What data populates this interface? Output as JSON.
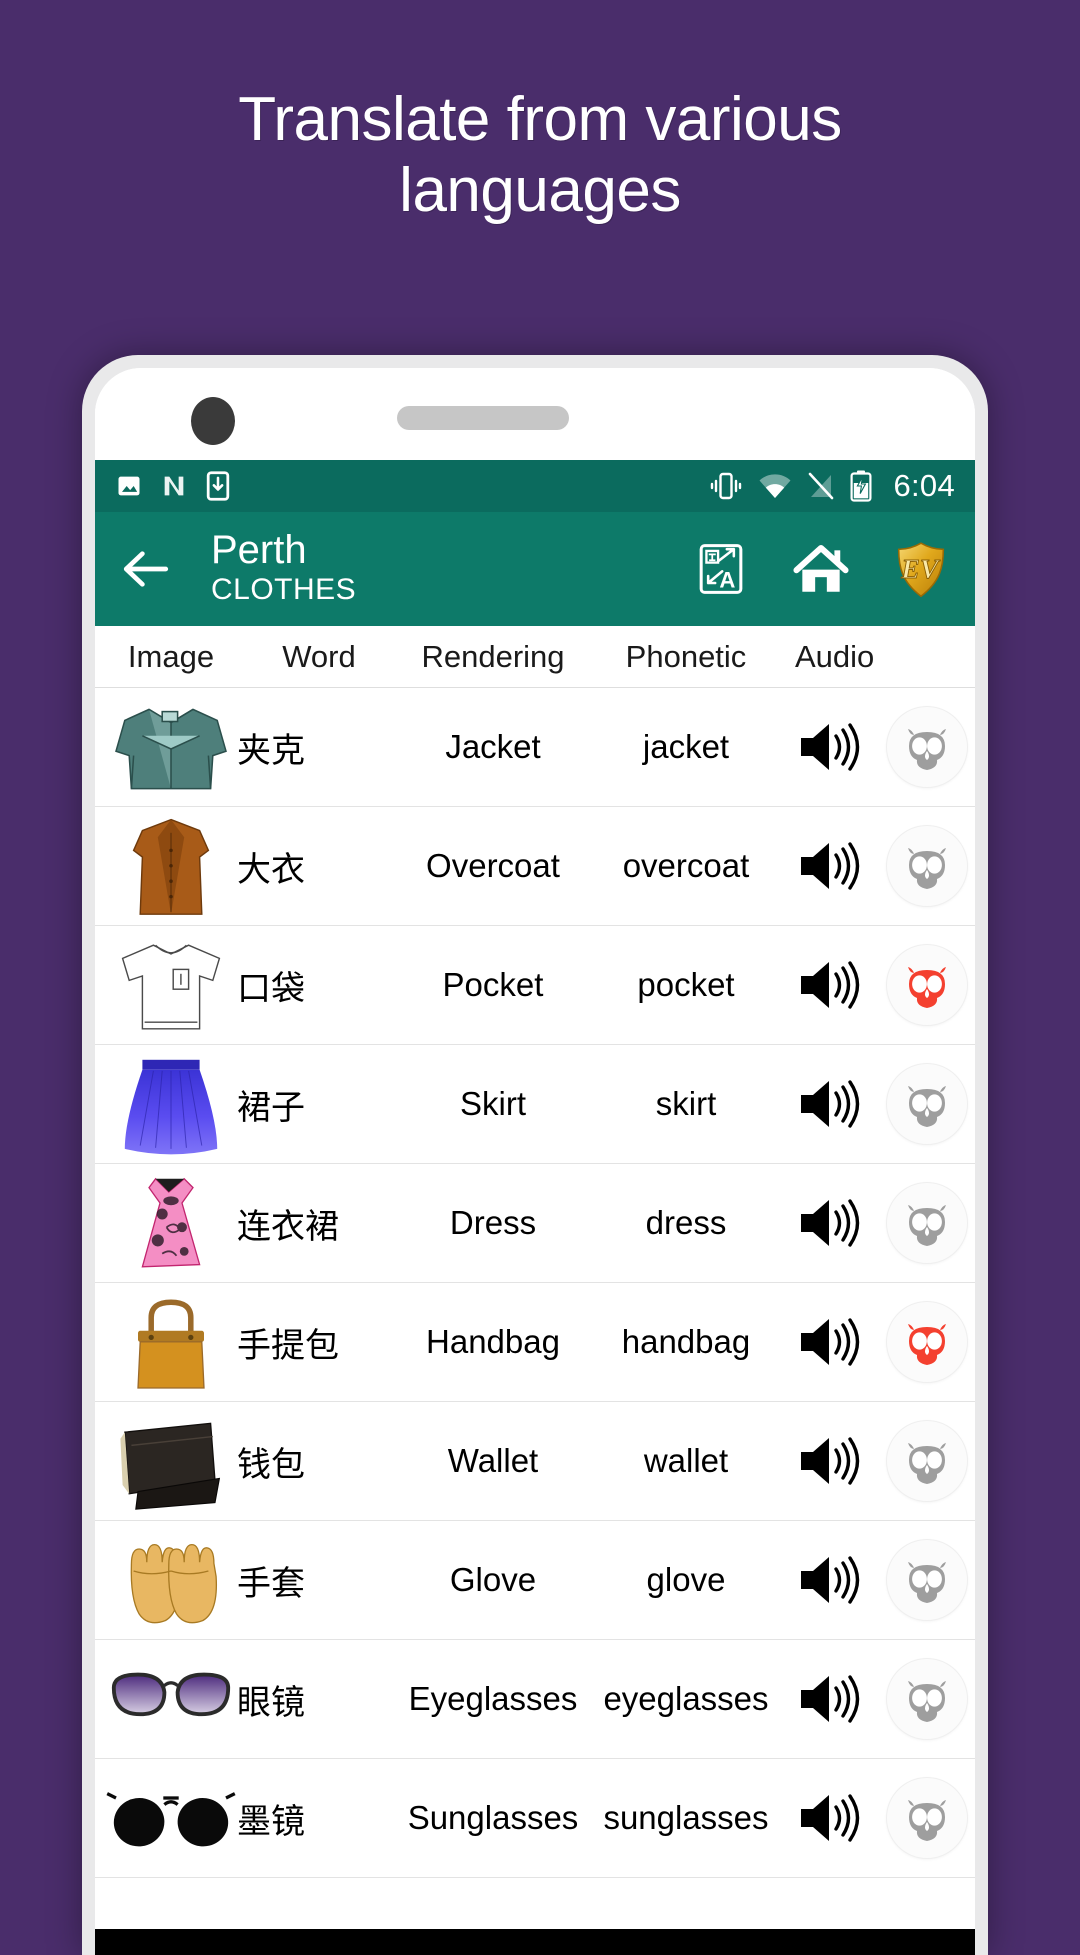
{
  "headline": {
    "line1": "Translate from various",
    "line2": "languages"
  },
  "colors": {
    "background": "#4a2d6b",
    "statusbar": "#0b6b5e",
    "appbar": "#0d7a69",
    "owl_active": "#f4402f",
    "owl_inactive": "#9e9e9e",
    "logo_gold": "#e8b722"
  },
  "statusbar": {
    "icons_left": [
      "image-icon",
      "nova-launcher-icon",
      "download-icon"
    ],
    "icons_right": [
      "vibrate-icon",
      "wifi-icon",
      "signal-off-icon",
      "battery-charging-icon"
    ],
    "clock": "6:04"
  },
  "appbar": {
    "back_icon": "back-arrow-icon",
    "title": "Perth",
    "subtitle": "CLOTHES",
    "actions": [
      {
        "name": "translate-icon",
        "label": "Translate"
      },
      {
        "name": "home-icon",
        "label": "Home"
      },
      {
        "name": "ev-logo-icon",
        "label": "EV"
      }
    ]
  },
  "table": {
    "headers": [
      "Image",
      "Word",
      "Rendering",
      "Phonetic",
      "Audio"
    ],
    "rows": [
      {
        "image": "jacket-image",
        "word": "夹克",
        "rendering": "Jacket",
        "phonetic": "jacket",
        "speaker": "speaker-icon",
        "owl": "owl-icon",
        "owl_state": "inactive"
      },
      {
        "image": "overcoat-image",
        "word": "大衣",
        "rendering": "Overcoat",
        "phonetic": "overcoat",
        "speaker": "speaker-icon",
        "owl": "owl-icon",
        "owl_state": "inactive"
      },
      {
        "image": "pocket-shirt-image",
        "word": "口袋",
        "rendering": "Pocket",
        "phonetic": "pocket",
        "speaker": "speaker-icon",
        "owl": "owl-icon",
        "owl_state": "active"
      },
      {
        "image": "skirt-image",
        "word": "裙子",
        "rendering": "Skirt",
        "phonetic": "skirt",
        "speaker": "speaker-icon",
        "owl": "owl-icon",
        "owl_state": "inactive"
      },
      {
        "image": "dress-image",
        "word": "连衣裙",
        "rendering": "Dress",
        "phonetic": "dress",
        "speaker": "speaker-icon",
        "owl": "owl-icon",
        "owl_state": "inactive"
      },
      {
        "image": "handbag-image",
        "word": "手提包",
        "rendering": "Handbag",
        "phonetic": "handbag",
        "speaker": "speaker-icon",
        "owl": "owl-icon",
        "owl_state": "active"
      },
      {
        "image": "wallet-image",
        "word": "钱包",
        "rendering": "Wallet",
        "phonetic": "wallet",
        "speaker": "speaker-icon",
        "owl": "owl-icon",
        "owl_state": "inactive"
      },
      {
        "image": "glove-image",
        "word": "手套",
        "rendering": "Glove",
        "phonetic": "glove",
        "speaker": "speaker-icon",
        "owl": "owl-icon",
        "owl_state": "inactive"
      },
      {
        "image": "eyeglasses-image",
        "word": "眼镜",
        "rendering": "Eyeglasses",
        "phonetic": "eyeglasses",
        "speaker": "speaker-icon",
        "owl": "owl-icon",
        "owl_state": "inactive"
      },
      {
        "image": "sunglasses-image",
        "word": "墨镜",
        "rendering": "Sunglasses",
        "phonetic": "sunglasses",
        "speaker": "speaker-icon",
        "owl": "owl-icon",
        "owl_state": "inactive"
      }
    ]
  }
}
